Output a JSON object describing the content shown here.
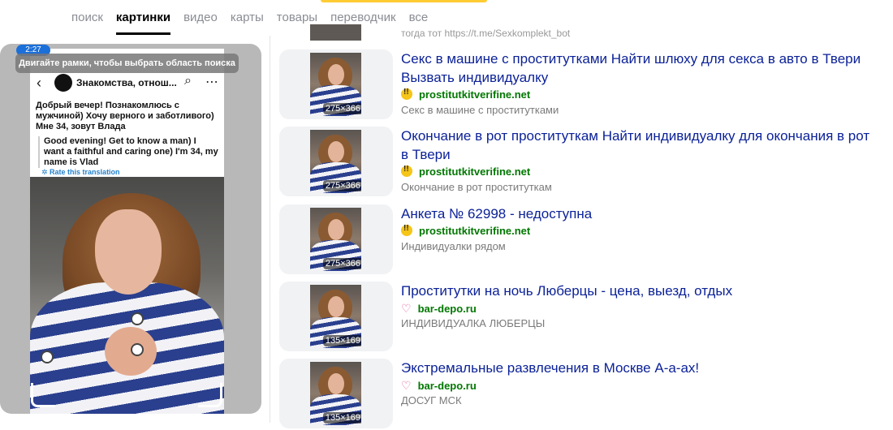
{
  "tabs": [
    {
      "label": "поиск",
      "active": false
    },
    {
      "label": "картинки",
      "active": true
    },
    {
      "label": "видео",
      "active": false
    },
    {
      "label": "карты",
      "active": false
    },
    {
      "label": "товары",
      "active": false
    },
    {
      "label": "переводчик",
      "active": false
    },
    {
      "label": "все",
      "active": false
    }
  ],
  "accent_color": "#ffcc33",
  "left_panel": {
    "status_time": "2:27",
    "hint": "Двигайте рамки, чтобы выбрать область поиска",
    "channel_title": "Знакомства, отнош...",
    "message_ru": "Добрый вечер! Познакомлюсь с мужчиной) Хочу верного и заботливого) Мне 34, зовут Влада",
    "message_en": "Good evening! Get to know a man) I want a faithful and caring one) I'm 34, my name is Vlad",
    "rate_translation": "✲ Rate this translation",
    "icons": [
      "back-arrow-icon",
      "search-icon",
      "more-dots-icon"
    ]
  },
  "top_snippet": "тогда тот https://t.me/Sexkomplekt_bot",
  "results": [
    {
      "title": "Секс в машине с проститутками Найти шлюху для секса в авто в Твери Вызвать индивидуалку",
      "site": "prostitutkitverifine.net",
      "favicon": "exclamation-icon",
      "description": "Секс в машине с проститутками",
      "size": "275×366"
    },
    {
      "title": "Окончание в рот проституткам Найти индивидуалку для окончания в рот в Твери",
      "site": "prostitutkitverifine.net",
      "favicon": "exclamation-icon",
      "description": "Окончание в рот проституткам",
      "size": "275×366"
    },
    {
      "title": "Анкета № 62998 - недоступна",
      "site": "prostitutkitverifine.net",
      "favicon": "exclamation-icon",
      "description": "Индивидуалки рядом",
      "size": "275×366"
    },
    {
      "title": "Проститутки на ночь Люберцы - цена, выезд, отдых",
      "site": "bar-depo.ru",
      "favicon": "heart-icon",
      "description": "ИНДИВИДУАЛКА ЛЮБЕРЦЫ",
      "size": "135×169"
    },
    {
      "title": "Экстремальные развлечения в Москве А-а-ах!",
      "site": "bar-depo.ru",
      "favicon": "heart-icon",
      "description": "ДОСУГ МСК",
      "size": "135×169"
    }
  ]
}
